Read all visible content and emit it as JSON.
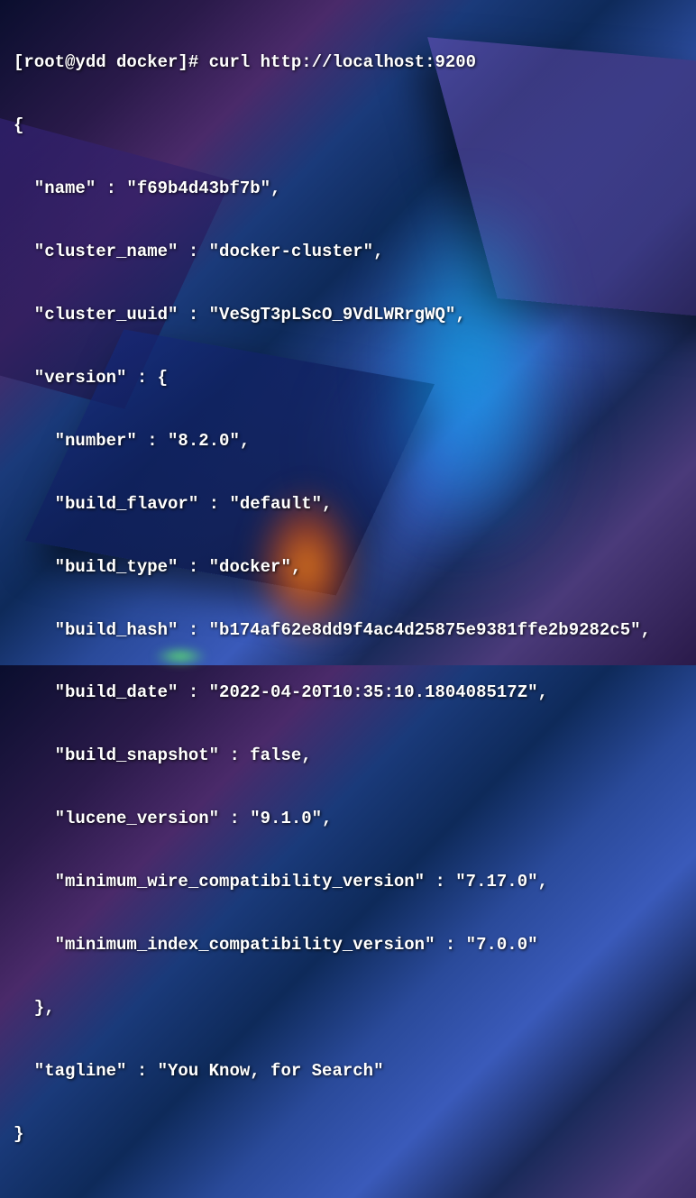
{
  "terminal": {
    "prompt": "[root@ydd docker]# ",
    "command": "curl http://localhost:9200",
    "output": {
      "open_brace": "{",
      "name_line": "  \"name\" : \"f69b4d43bf7b\",",
      "cluster_name_line": "  \"cluster_name\" : \"docker-cluster\",",
      "cluster_uuid_line": "  \"cluster_uuid\" : \"VeSgT3pLScO_9VdLWRrgWQ\",",
      "version_open": "  \"version\" : {",
      "number_line": "    \"number\" : \"8.2.0\",",
      "build_flavor_line": "    \"build_flavor\" : \"default\",",
      "build_type_line": "    \"build_type\" : \"docker\",",
      "build_hash_line": "    \"build_hash\" : \"b174af62e8dd9f4ac4d25875e9381ffe2b9282c5\",",
      "build_date_line": "    \"build_date\" : \"2022-04-20T10:35:10.180408517Z\",",
      "build_snapshot_line": "    \"build_snapshot\" : false,",
      "lucene_version_line": "    \"lucene_version\" : \"9.1.0\",",
      "min_wire_line": "    \"minimum_wire_compatibility_version\" : \"7.17.0\",",
      "min_index_line": "    \"minimum_index_compatibility_version\" : \"7.0.0\"",
      "version_close": "  },",
      "tagline_line": "  \"tagline\" : \"You Know, for Search\"",
      "close_brace": "}"
    }
  }
}
